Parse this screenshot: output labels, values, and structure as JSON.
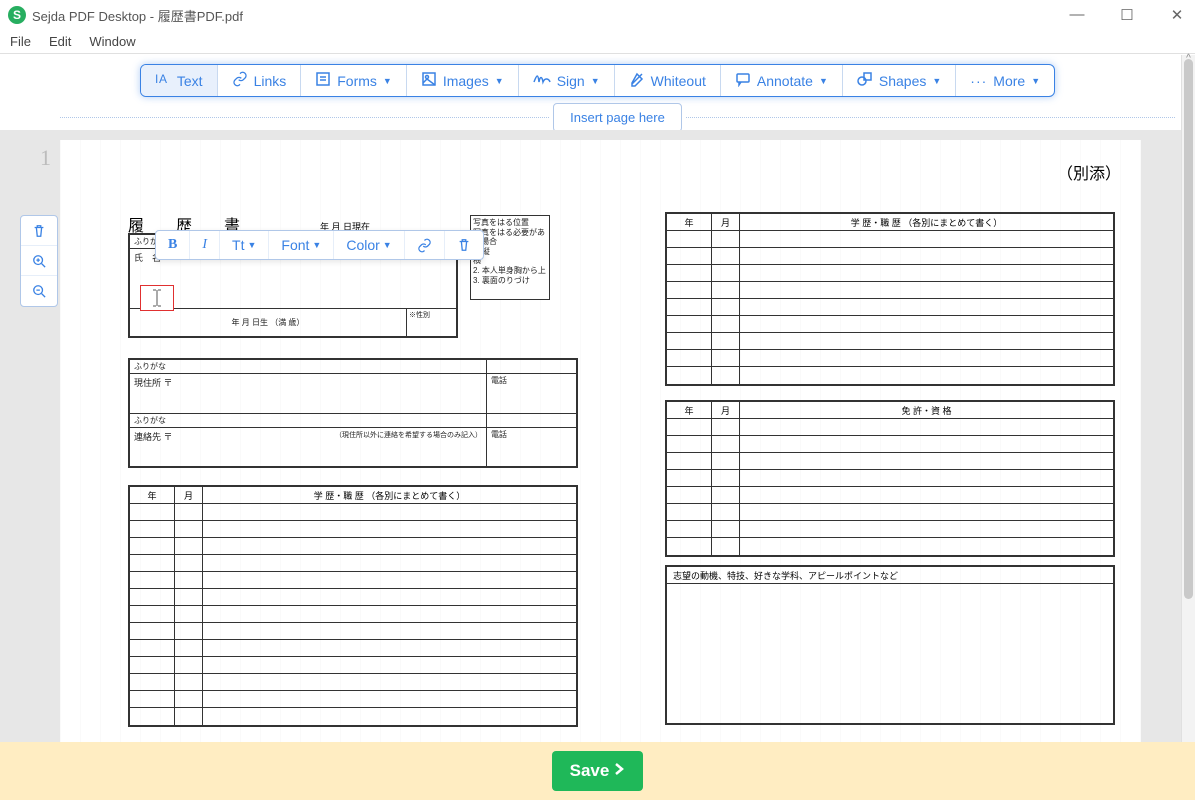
{
  "window": {
    "title": "Sejda PDF Desktop - 履歴書PDF.pdf",
    "min": "—",
    "max": "☐",
    "close": "✕"
  },
  "menu": {
    "file": "File",
    "edit": "Edit",
    "window": "Window"
  },
  "toolbar": {
    "text": "Text",
    "links": "Links",
    "forms": "Forms",
    "images": "Images",
    "sign": "Sign",
    "whiteout": "Whiteout",
    "annotate": "Annotate",
    "shapes": "Shapes",
    "more": "More"
  },
  "insert": {
    "label": "Insert page here"
  },
  "page_num": "1",
  "page": {
    "attach_label": "（別添）",
    "rirekisho": "履　歴　書",
    "date_line": "年     月     日現在",
    "photo_note": "写真をはる位置\n写真をはる必要がある場合\n1. 縦\n   横\n2. 本人単身胸から上\n3. 裏面のりづけ",
    "furigana": "ふりがな",
    "name_label": "氏　名",
    "birth_line": "年      月      日生     （満      歳）",
    "sex_label": "※性別",
    "current_addr": "現住所   〒",
    "phone": "電話",
    "contact": "連絡先   〒",
    "contact_note": "（現住所以外に連絡を希望する場合のみ記入）",
    "edu_header": "学  歴・職  歴  （各別にまとめて書く）",
    "license_header": "免  許・資  格",
    "motive_header": "志望の動機、特技、好きな学科、アピールポイントなど",
    "year": "年",
    "month": "月"
  },
  "text_toolbar": {
    "bold": "B",
    "italic": "I",
    "size": "Tt",
    "font": "Font",
    "color": "Color"
  },
  "save": {
    "label": "Save"
  }
}
